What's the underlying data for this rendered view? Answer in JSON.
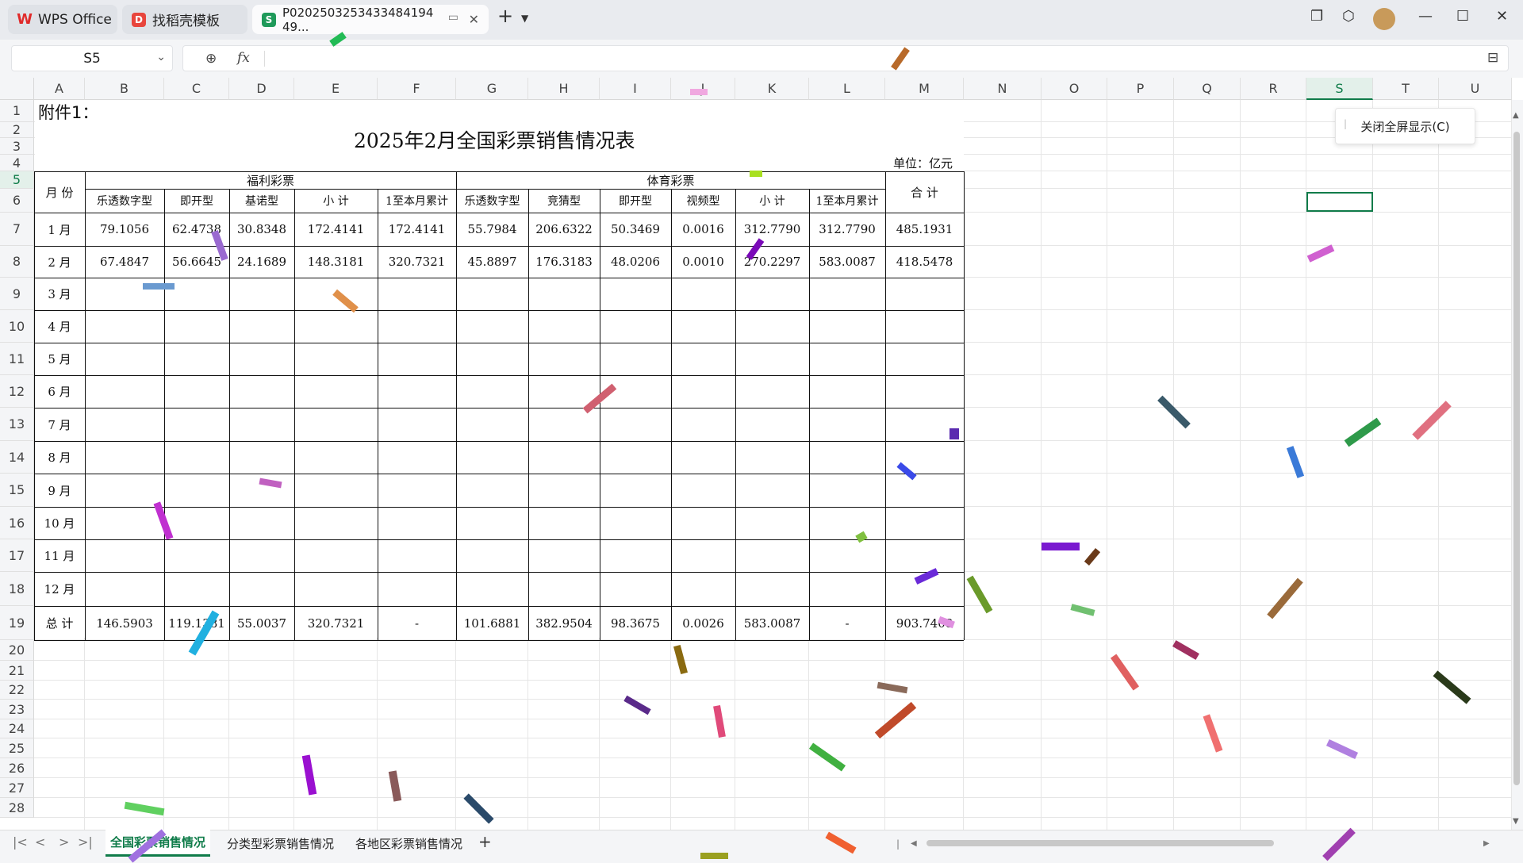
{
  "tabs": [
    {
      "label": "WPS Office",
      "icon": "wps-logo-icon"
    },
    {
      "label": "找稻壳模板",
      "icon": "daoke-icon"
    },
    {
      "label": "P0202503253433484194​49...",
      "icon": "spreadsheet-icon"
    }
  ],
  "name_box": "S5",
  "fx_label": "fx",
  "columns": [
    "A",
    "B",
    "C",
    "D",
    "E",
    "F",
    "G",
    "H",
    "I",
    "J",
    "K",
    "L",
    "M",
    "N",
    "O",
    "P",
    "Q",
    "R",
    "S",
    "T",
    "U"
  ],
  "rows": [
    "1",
    "2",
    "3",
    "4",
    "5",
    "6",
    "7",
    "8",
    "9",
    "10",
    "11",
    "12",
    "13",
    "14",
    "15",
    "16",
    "17",
    "18",
    "19",
    "20",
    "21",
    "22",
    "23",
    "24",
    "25",
    "26",
    "27",
    "28"
  ],
  "sheet": {
    "attachment": "附件1：",
    "title": "2025年2月全国彩票销售情况表",
    "unit": "单位：亿元",
    "month_header": "月  份",
    "welfare_header": "福利彩票",
    "sports_header": "体育彩票",
    "total_header": "合  计",
    "sub_headers": [
      "乐透数字型",
      "即开型",
      "基诺型",
      "小  计",
      "1至本月累计",
      "乐透数字型",
      "竞猜型",
      "即开型",
      "视频型",
      "小  计",
      "1至本月累计"
    ],
    "months": [
      "1  月",
      "2  月",
      "3  月",
      "4  月",
      "5  月",
      "6  月",
      "7  月",
      "8  月",
      "9  月",
      "10  月",
      "11  月",
      "12  月"
    ],
    "total_label": "总  计",
    "data": [
      [
        "79.1056",
        "62.4738",
        "30.8348",
        "172.4141",
        "172.4141",
        "55.7984",
        "206.6322",
        "50.3469",
        "0.0016",
        "312.7790",
        "312.7790",
        "485.1931"
      ],
      [
        "67.4847",
        "56.6645",
        "24.1689",
        "148.3181",
        "320.7321",
        "45.8897",
        "176.3183",
        "48.0206",
        "0.0010",
        "270.2297",
        "583.0087",
        "418.5478"
      ]
    ],
    "totals": [
      "146.5903",
      "119.1381",
      "55.0037",
      "320.7321",
      "-",
      "101.6881",
      "382.9504",
      "98.3675",
      "0.0026",
      "583.0087",
      "-",
      "903.7408"
    ]
  },
  "close_fullscreen": "关闭全屏显示(C)",
  "sheet_tabs": [
    "全国彩票销售情况",
    "分类型彩票销售情况",
    "各地区彩票销售情况"
  ],
  "colors": {
    "accent": "#107c4a",
    "selection": "#e3f0ea"
  }
}
